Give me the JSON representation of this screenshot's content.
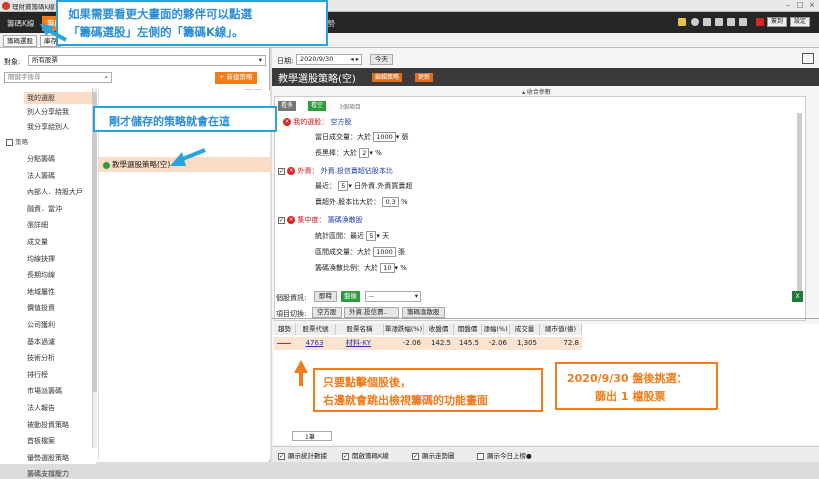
{
  "window": {
    "title": "理財寶籌碼k線1.2"
  },
  "main_tabs": {
    "chip_kline": "籌碼K線",
    "chip_select": "籌碼選",
    "trend": "走勢"
  },
  "topright": {
    "checkin": "簽到",
    "settings": "設定"
  },
  "sub_tabs": {
    "chip_select": "籌碼選股",
    "inventory": "庫存"
  },
  "left": {
    "target_label": "對象:",
    "target_value": "所有股票",
    "search_placeholder": "關鍵字搜尋",
    "new_strategy": "+ 新建策略",
    "tree": {
      "mine": "我的選股",
      "shared_to_me": "別人分享給我",
      "i_shared": "我分享給別人",
      "strategy_cat": "策略",
      "items": [
        "分點籌碼",
        "法人籌碼",
        "內部人．持股大戶",
        "融資．當沖",
        "張詳細",
        "成交量",
        "均線抉擇",
        "長期均線",
        "地域屬性",
        "價值投資",
        "公司獲利",
        "基本過濾",
        "技術分析",
        "排行榜",
        "市場派籌碼",
        "法人報告",
        "被動投資策略",
        "首板檔案",
        "優勢選股策略",
        "籌碼支撐壓力"
      ]
    },
    "strategy_item": "教學選股策略(空)"
  },
  "right": {
    "date_label": "日期:",
    "date": "2020/9/30",
    "today": "今天",
    "strategy_name": "教學選股策略(空)",
    "edit_btn": "編輯策略",
    "update_btn": "更新",
    "collapse": "收合參數",
    "view_many": "看多",
    "view_short": "看空",
    "count": "3個項目",
    "cond1": {
      "title": "我的選股：",
      "value": "空方股",
      "l1a": "當日成交量：大於",
      "l1v": "1000",
      "l1u": "張",
      "l2a": "長黑棒：大於",
      "l2v": "2",
      "l2u": "%"
    },
    "cond2": {
      "title": "外資：",
      "value": "外資.投信賣超佔股本比",
      "l1a": "最近：",
      "l1v": "5",
      "l1u": "日外資.外資買賣超",
      "l2a": "賣超外.股本比大於：",
      "l2v": "0.3",
      "l2u": "%"
    },
    "cond3": {
      "title": "集中度：",
      "value": "籌碼渙散股",
      "l1a": "統計區間：最近",
      "l1v": "5",
      "l1u": "天",
      "l2a": "區間成交量：大於",
      "l2v": "1000",
      "l2u": "張",
      "l3a": "籌碼渙散比例：大於",
      "l3v": "10",
      "l3u": "%"
    },
    "stock_info_label": "個股資訊:",
    "realtime": "即時",
    "after": "盤後",
    "dash": "--",
    "item_switch_label": "項目切換:",
    "sw1": "空方股",
    "sw2": "外資.投信賣..",
    "sw3": "籌碼渙散股",
    "columns": [
      "趨勢",
      "股票代號",
      "股票名稱",
      "單漲跌幅(%)",
      "收盤價",
      "開盤價",
      "漲幅(%)",
      "成交量",
      "總市值(億)"
    ],
    "row": {
      "code": "4763",
      "name": "材料-KY",
      "chg": "-2.06",
      "close": "142.5",
      "open": "145.5",
      "pct": "-2.06",
      "vol": "1,305",
      "cap": "72.8"
    },
    "page": "1筆",
    "footer": [
      "顯示統計數據",
      "開啟籌碼K線",
      "顯示走勢圖",
      "顯示今日上榜●"
    ]
  },
  "annotations": {
    "a1_line1": "如果需要看更大畫面的夥伴可以點選",
    "a1_line2": "「籌碼選股」左側的「籌碼K線」。",
    "a2": "剛才儲存的策略就會在這",
    "a3_line1": "只要點擊個股後，",
    "a3_line2": "右邊就會跳出檢視籌碼的功能畫面",
    "a4_line1": "2020/9/30 盤後挑選：",
    "a4_line2": "篩出 1 檔股票"
  },
  "colors": {
    "accent": "#f07c1b",
    "annotation_blue": "#29a3de",
    "annotation_orange": "#f07c1b",
    "red": "#c8161e"
  }
}
